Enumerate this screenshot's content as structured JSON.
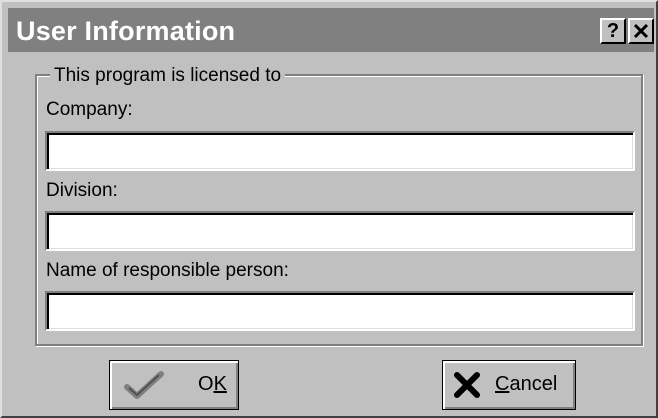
{
  "window": {
    "title": "User Information",
    "help_label": "?",
    "close_label": "✕"
  },
  "group": {
    "title": "This program is licensed to"
  },
  "fields": {
    "company_label": "Company:",
    "company_value": "",
    "division_label": "Division:",
    "division_value": "",
    "person_label": "Name of responsible person:",
    "person_value": ""
  },
  "buttons": {
    "ok_label_first": "O",
    "ok_label_rest": "K",
    "ok_icon": "checkmark-icon",
    "cancel_label_first": "C",
    "cancel_label_rest": "ancel",
    "cancel_icon": "x-icon"
  },
  "colors": {
    "titlebar": "#808080",
    "face": "#c0c0c0",
    "ok_check": "#808080",
    "cancel_x": "#000000"
  }
}
